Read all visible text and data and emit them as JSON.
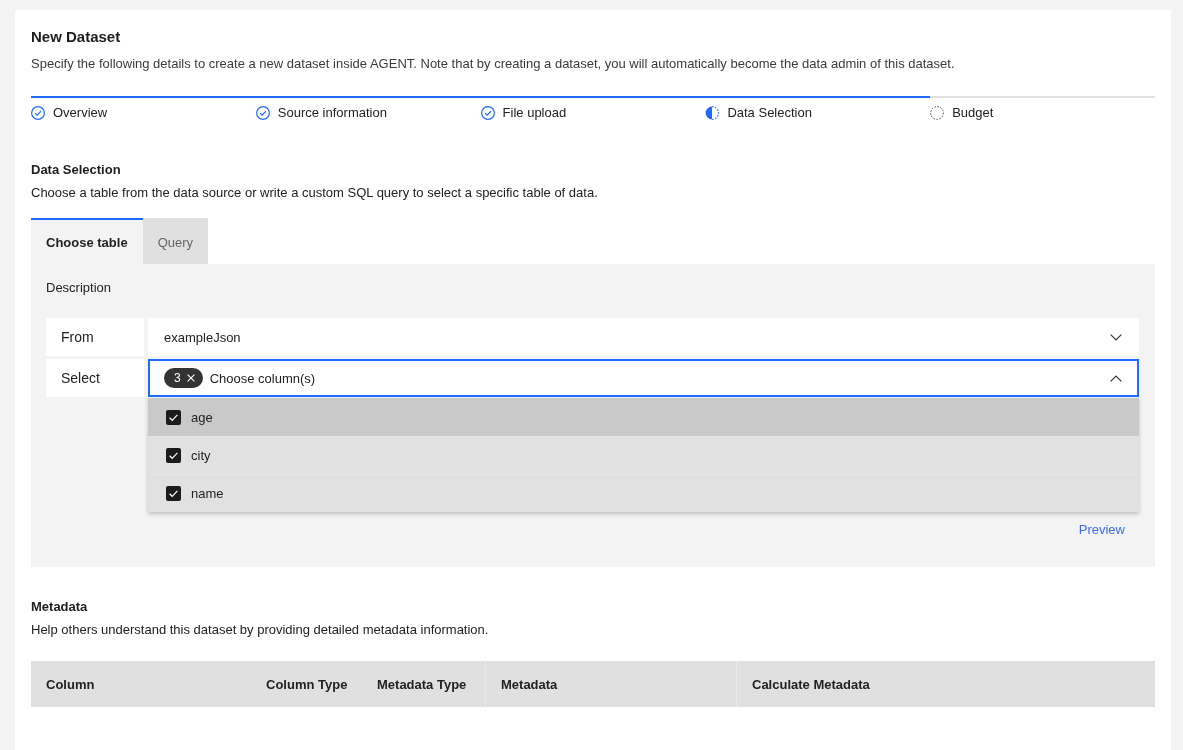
{
  "page": {
    "title": "New Dataset",
    "description": "Specify the following details to create a new dataset inside AGENT. Note that by creating a dataset, you will automatically become the data admin of this dataset."
  },
  "steps": [
    {
      "label": "Overview",
      "completed": true,
      "active": false
    },
    {
      "label": "Source information",
      "completed": true,
      "active": false
    },
    {
      "label": "File upload",
      "completed": true,
      "active": false
    },
    {
      "label": "Data Selection",
      "completed": false,
      "active": true
    },
    {
      "label": "Budget",
      "completed": false,
      "active": false
    }
  ],
  "data_selection": {
    "heading": "Data Selection",
    "description": "Choose a table from the data source or write a custom SQL query to select a specific table of data.",
    "tabs": [
      {
        "label": "Choose table",
        "selected": true
      },
      {
        "label": "Query",
        "selected": false
      }
    ],
    "panel": {
      "title": "Description",
      "fields": [
        {
          "kind": "dropdown",
          "label": "From",
          "value": "exampleJson",
          "expanded": false
        },
        {
          "kind": "multiselect",
          "label": "Select",
          "count": "3",
          "placeholder": "Choose column(s)",
          "expanded": true,
          "options": [
            {
              "label": "age",
              "checked": true,
              "highlighted": true
            },
            {
              "label": "city",
              "checked": true,
              "highlighted": false
            },
            {
              "label": "name",
              "checked": true,
              "highlighted": false
            }
          ]
        }
      ],
      "link": "Preview"
    }
  },
  "metadata": {
    "heading": "Metadata",
    "description": "Help others understand this dataset by providing detailed metadata information.",
    "table": {
      "columns": [
        "Column",
        "Column Type",
        "Metadata Type",
        "Metadata",
        "Calculate Metadata"
      ]
    }
  }
}
